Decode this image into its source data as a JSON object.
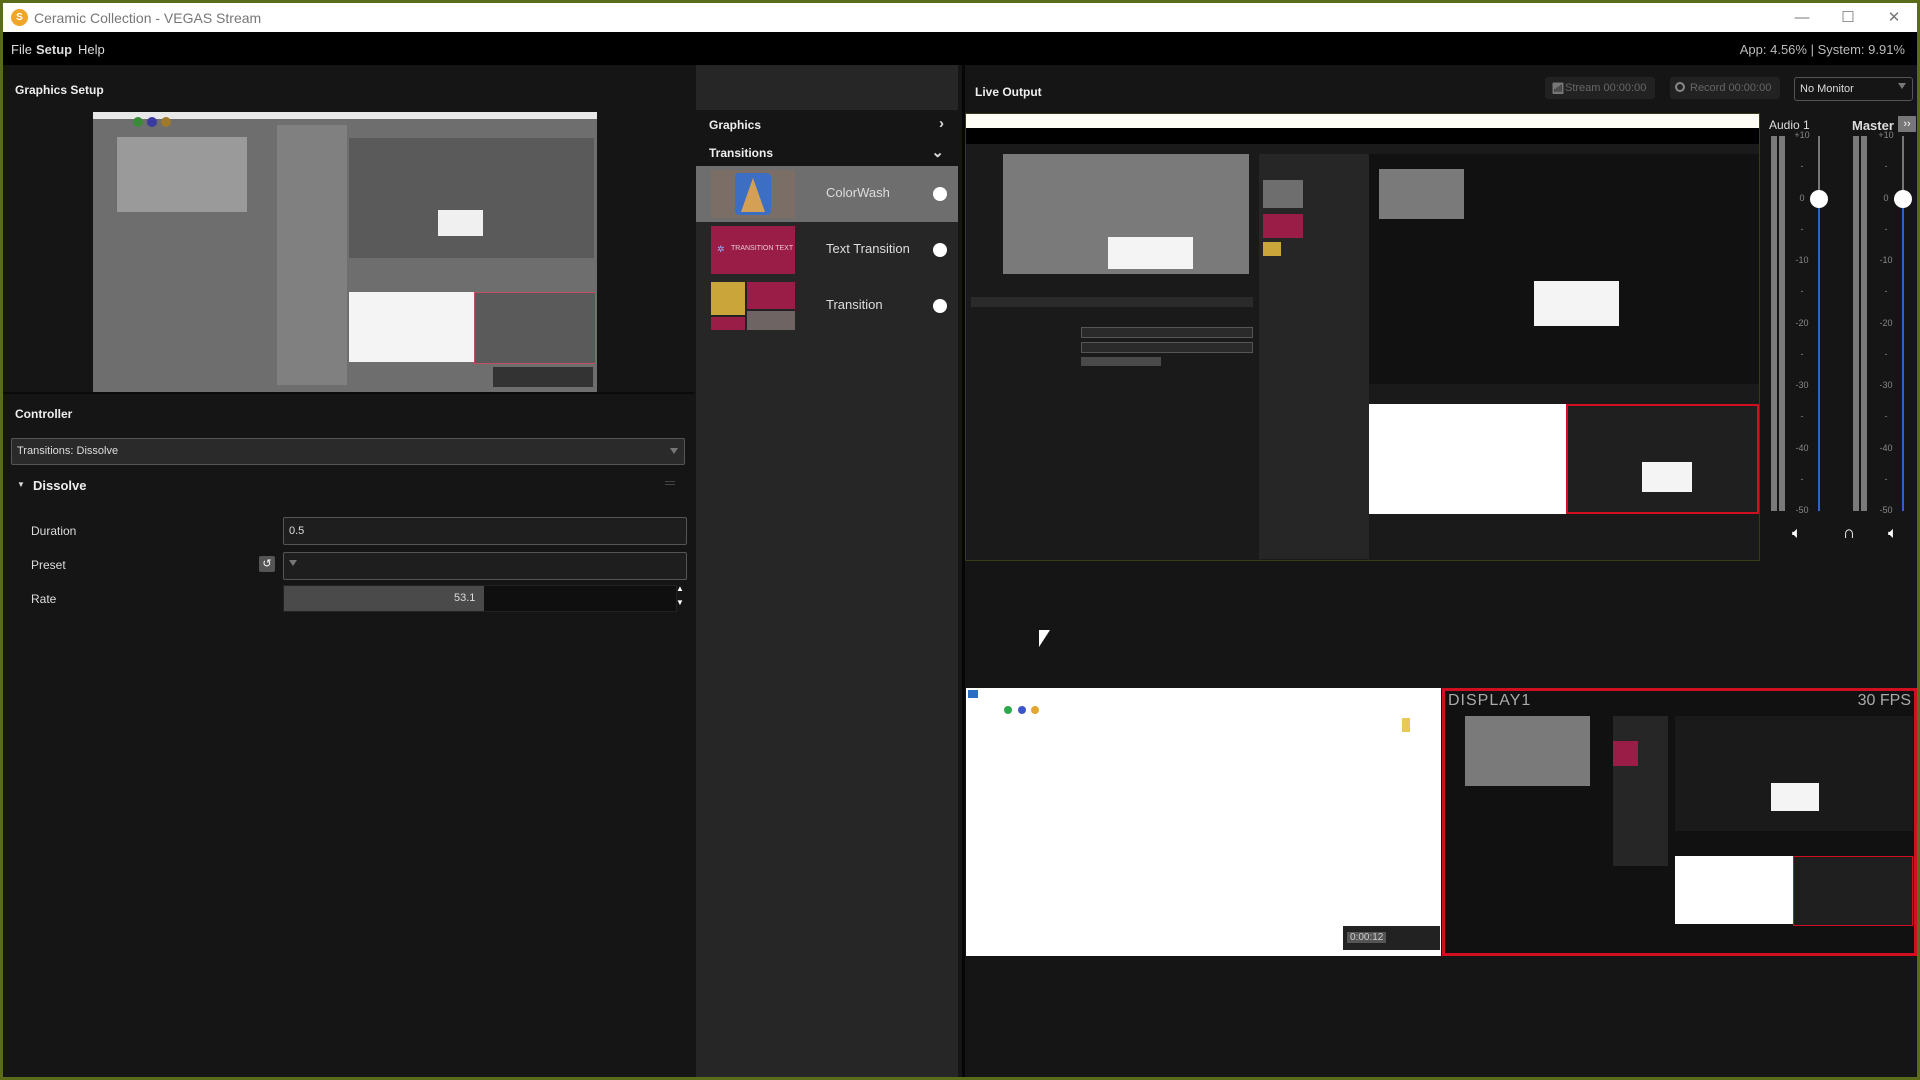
{
  "window": {
    "title": "Ceramic Collection - VEGAS Stream",
    "logo_letter": "S",
    "controls": {
      "minimize": "—",
      "maximize": "☐",
      "close": "✕"
    }
  },
  "menu": {
    "items": [
      "File",
      "Setup",
      "Help"
    ],
    "stats": "App: 4.56% | System: 9.91%"
  },
  "graphics_setup": {
    "title": "Graphics Setup"
  },
  "controller": {
    "title": "Controller",
    "selector_value": "Transitions: Dissolve",
    "section_title": "Dissolve",
    "fields": {
      "duration_label": "Duration",
      "duration_value": "0.5",
      "preset_label": "Preset",
      "preset_value": "",
      "rate_label": "Rate",
      "rate_value": "53.1",
      "rate_fill_fraction": 0.51
    }
  },
  "library": {
    "graphics_label": "Graphics",
    "transitions_label": "Transitions",
    "items": [
      {
        "label": "ColorWash",
        "selected": true
      },
      {
        "label": "Text Transition",
        "thumb_text": "TRANSITION TEXT",
        "selected": false
      },
      {
        "label": "Transition",
        "selected": false
      }
    ]
  },
  "live_output": {
    "title": "Live Output",
    "stream_label": "Stream 00:00:00",
    "record_label": "Record 00:00:00",
    "monitor_select": "No Monitor"
  },
  "mixer": {
    "channels": [
      {
        "name": "Audio 1",
        "level_db": 0
      },
      {
        "name": "Master",
        "level_db": 0
      }
    ],
    "scale": [
      "+10",
      "-",
      "0",
      "-",
      "-10",
      "-",
      "-20",
      "-",
      "-30",
      "-",
      "-40",
      "-",
      "-50"
    ],
    "expand_label": "››"
  },
  "display": {
    "label": "DISPLAY1",
    "fps": "30 FPS",
    "timer": "0:00:12"
  },
  "colors": {
    "accent_blue": "#2f63c4",
    "selection_red": "#d01020",
    "transition_magenta": "#9a1d48",
    "transition_gold": "#c9a53a"
  }
}
